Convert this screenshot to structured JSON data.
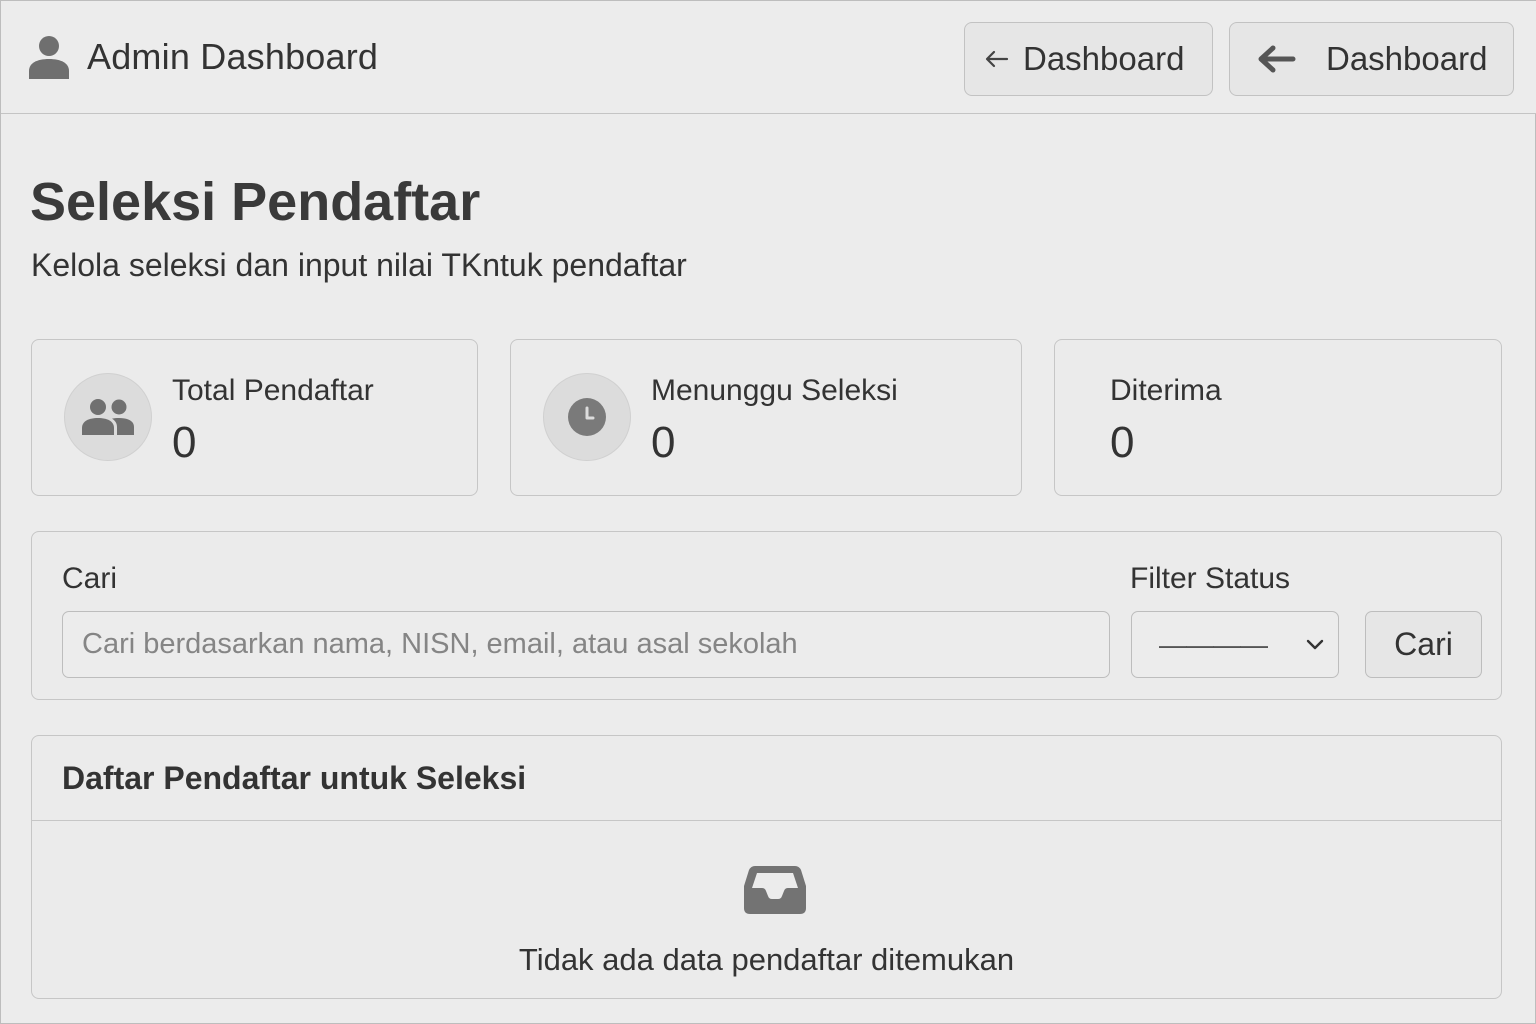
{
  "header": {
    "title": "Admin Dashboard",
    "nav_buttons": [
      {
        "label": "Dashboard",
        "icon": "arrow-left-icon"
      },
      {
        "label": "Dashboard",
        "icon": "arrow-left-bold-icon"
      }
    ]
  },
  "page": {
    "title": "Seleksi Pendaftar",
    "subtitle": "Kelola seleksi dan input nilai TKntuk pendaftar"
  },
  "stats": [
    {
      "label": "Total Pendaftar",
      "value": "0",
      "icon": "users-icon"
    },
    {
      "label": "Menunggu Seleksi",
      "value": "0",
      "icon": "clock-icon"
    },
    {
      "label": "Diterima",
      "value": "0"
    }
  ],
  "filter": {
    "search_label": "Cari",
    "search_placeholder": "Cari berdasarkan nama, NISN, email, atau asal sekolah",
    "search_value": "",
    "status_label": "Filter Status",
    "status_selected": "————",
    "button_label": "Cari"
  },
  "list": {
    "title": "Daftar Pendaftar untuk Seleksi",
    "empty_icon": "inbox-icon",
    "empty_message": "Tidak ada data pendaftar ditemukan"
  },
  "colors": {
    "background": "#ececec",
    "border": "#c6c6c6",
    "icon_gray": "#6f6f6f",
    "text": "#333333"
  }
}
